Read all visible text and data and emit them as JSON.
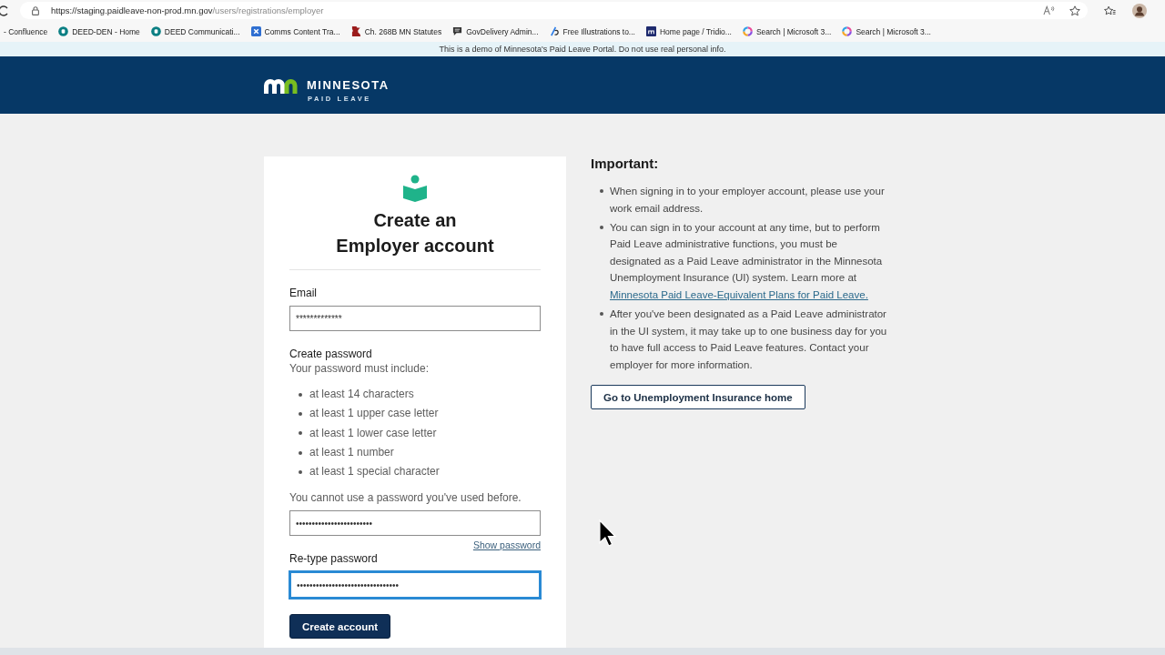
{
  "browser": {
    "url_host": "https://staging.paidleave-non-prod.mn.gov",
    "url_path": "/users/registrations/employer"
  },
  "bookmarks": [
    {
      "label": "- Confluence",
      "kind": "none"
    },
    {
      "label": "DEED-DEN - Home",
      "kind": "circle"
    },
    {
      "label": "DEED Communicati...",
      "kind": "circle"
    },
    {
      "label": "Comms Content Tra...",
      "kind": "square-x"
    },
    {
      "label": "Ch. 268B MN Statutes",
      "kind": "state"
    },
    {
      "label": "GovDelivery Admin...",
      "kind": "bubble"
    },
    {
      "label": "Free Illustrations to...",
      "kind": "slash"
    },
    {
      "label": "Home page / Tridio...",
      "kind": "tile"
    },
    {
      "label": "Search | Microsoft 3...",
      "kind": "ring"
    },
    {
      "label": "Search | Microsoft 3...",
      "kind": "ring"
    }
  ],
  "demo_banner": "This is a demo of Minnesota's Paid Leave Portal. Do not use real personal info.",
  "header": {
    "logo_title": "MINNESOTA",
    "logo_subtitle": "PAID LEAVE"
  },
  "form": {
    "title": "Create an Employer account",
    "email": {
      "label": "Email",
      "value": "*************",
      "focused": false
    },
    "password_section": {
      "label": "Create password",
      "hint": "Your password must include:",
      "requirements": [
        "at least 14 characters",
        "at least 1 upper case letter",
        "at least 1 lower case letter",
        "at least 1 number",
        "at least 1 special character"
      ],
      "note": "You cannot use a password you've used before."
    },
    "password": {
      "value": "••••••••••••••••••••••••",
      "focused": false
    },
    "show_password": "Show password",
    "retype": {
      "label": "Re-type password",
      "value": "••••••••••••••••••••••••••••••••",
      "focused": true
    },
    "submit": "Create account"
  },
  "important": {
    "heading": "Important:",
    "items": [
      {
        "text": "When signing in to your employer account, please use your work email address."
      },
      {
        "text": "You can sign in to your account at any time, but to perform Paid Leave administrative functions, you must be designated as a Paid Leave administrator in the Minnesota Unemployment Insurance (UI) system. Learn more at ",
        "link": "Minnesota Paid Leave-Equivalent Plans for Paid Leave."
      },
      {
        "text": "After you've been designated as a Paid Leave administrator in the UI system, it may take up to one business day for you to have full access to Paid Leave features. Contact your employer for more information."
      }
    ],
    "button": "Go to Unemployment Insurance home"
  }
}
